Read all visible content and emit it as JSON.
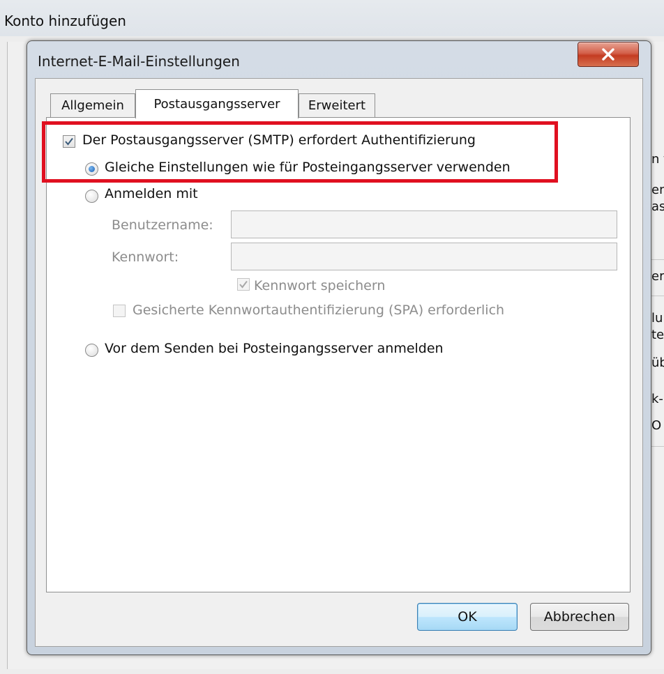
{
  "background_window": {
    "title": "Konto hinzufügen",
    "fragments": [
      "n t",
      "en",
      "as",
      "er",
      "lu",
      "te",
      "üb",
      "k-",
      "O"
    ]
  },
  "dialog": {
    "title": "Internet-E-Mail-Einstellungen",
    "close_label": "✕",
    "tabs": [
      {
        "label": "Allgemein",
        "active": false
      },
      {
        "label": "Postausgangsserver",
        "active": true
      },
      {
        "label": "Erweitert",
        "active": false
      }
    ],
    "options": {
      "smtp_auth_label": "Der Postausgangsserver (SMTP) erfordert Authentifizierung",
      "smtp_auth_checked": true,
      "same_settings_label": "Gleiche Einstellungen wie für Posteingangsserver verwenden",
      "same_settings_selected": true,
      "login_with_label": "Anmelden mit",
      "login_with_selected": false,
      "username_label": "Benutzername:",
      "username_value": "",
      "password_label": "Kennwort:",
      "password_value": "",
      "save_password_label": "Kennwort speichern",
      "save_password_checked": true,
      "spa_label": "Gesicherte Kennwortauthentifizierung (SPA) erforderlich",
      "spa_checked": false,
      "before_send_label": "Vor dem Senden bei Posteingangsserver anmelden",
      "before_send_selected": false
    },
    "buttons": {
      "ok": "OK",
      "cancel": "Abbrechen"
    }
  },
  "colors": {
    "highlight": "#e01020",
    "radio_selected": "#1a5fb4",
    "close_button": "#c43c22"
  }
}
